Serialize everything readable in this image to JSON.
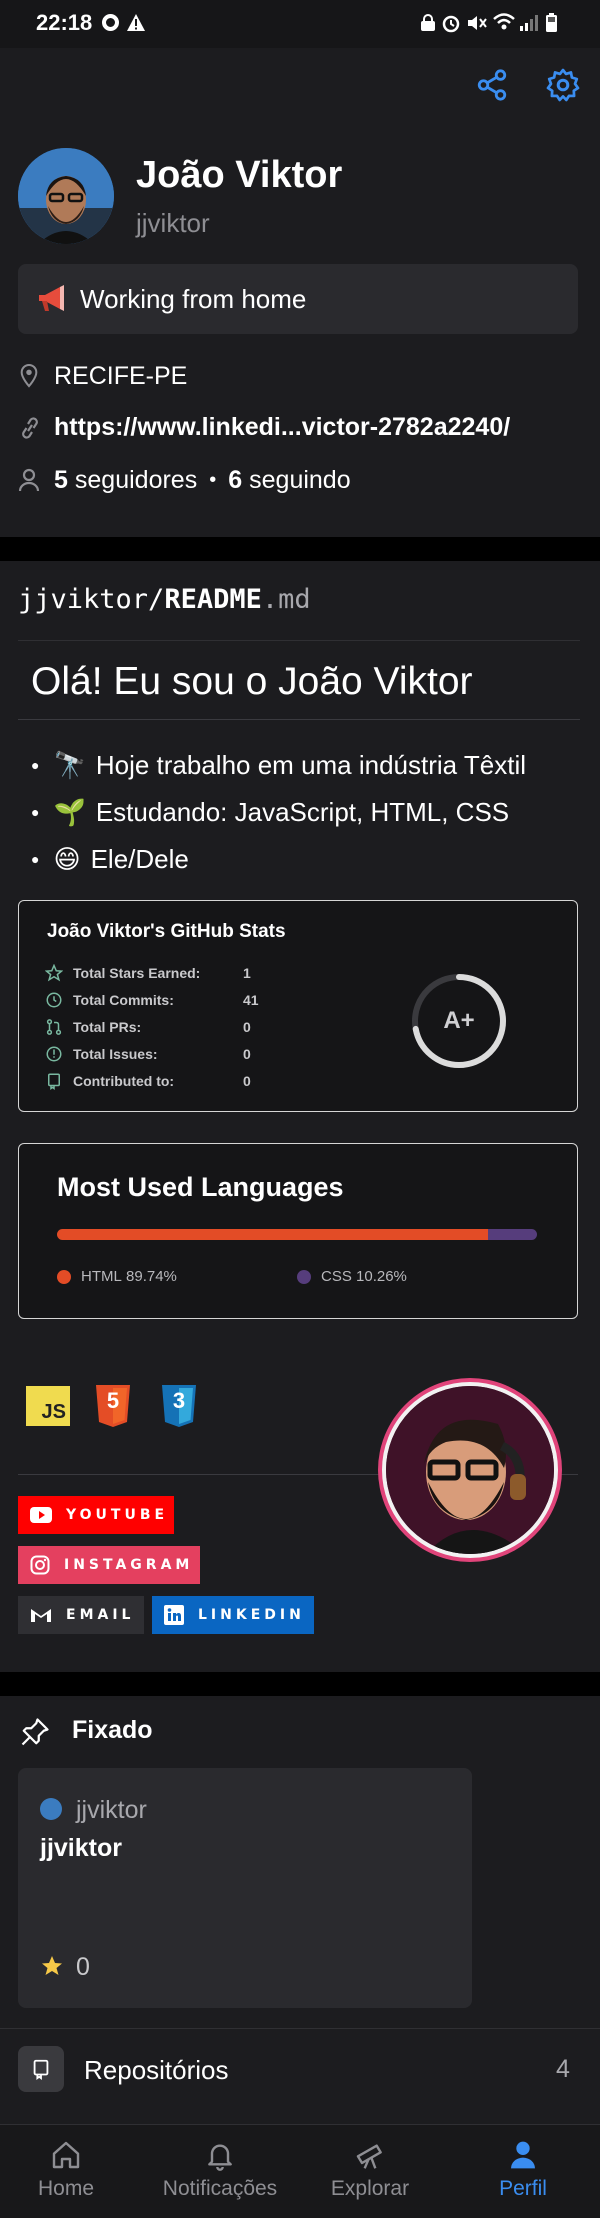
{
  "status_bar": {
    "time": "22:18"
  },
  "profile": {
    "name": "João Viktor",
    "username": "jjviktor",
    "status": "Working from home",
    "location": "RECIFE-PE",
    "link": "https://www.linkedi...victor-2782a2240/",
    "followers_count": "5",
    "followers_label": "seguidores",
    "following_count": "6",
    "following_label": "seguindo"
  },
  "readme": {
    "path_user": "jjviktor/",
    "path_file": "README",
    "path_ext": ".md",
    "heading": "Olá! Eu sou o João Viktor",
    "bullets": [
      {
        "emoji": "🔭",
        "text": "Hoje trabalho em uma indústria Têxtil"
      },
      {
        "emoji": "🌱",
        "text": "Estudando: JavaScript, HTML, CSS"
      },
      {
        "emoji": "😄",
        "text": "Ele/Dele"
      }
    ],
    "stats": {
      "title": "João Viktor's GitHub Stats",
      "rows": [
        {
          "label": "Total Stars Earned:",
          "value": "1",
          "icon": "star-icon"
        },
        {
          "label": "Total Commits:",
          "value": "41",
          "icon": "history-icon"
        },
        {
          "label": "Total PRs:",
          "value": "0",
          "icon": "pull-request-icon"
        },
        {
          "label": "Total Issues:",
          "value": "0",
          "icon": "issue-icon"
        },
        {
          "label": "Contributed to:",
          "value": "0",
          "icon": "repo-icon"
        }
      ],
      "grade": "A+",
      "grade_progress": 0.72
    },
    "languages": {
      "title": "Most Used Languages",
      "items": [
        {
          "name": "HTML",
          "percent": "89.74%",
          "share": 89.74,
          "color": "#e34c26"
        },
        {
          "name": "CSS",
          "percent": "10.26%",
          "share": 10.26,
          "color": "#563d7c"
        }
      ]
    },
    "tech_icons": [
      {
        "name": "javascript-icon",
        "label": "JS"
      },
      {
        "name": "html5-icon",
        "label": "5"
      },
      {
        "name": "css3-icon",
        "label": "3"
      }
    ],
    "badges": [
      {
        "label": "YOUTUBE",
        "color": "#ff0000",
        "icon": "youtube-icon"
      },
      {
        "label": "INSTAGRAM",
        "color": "#e4405f",
        "icon": "instagram-icon"
      },
      {
        "label": "EMAIL",
        "color": "#2f2f33",
        "icon": "gmail-icon"
      },
      {
        "label": "LINKEDIN",
        "color": "#0a66c2",
        "icon": "linkedin-icon"
      }
    ]
  },
  "pinned": {
    "heading": "Fixado",
    "card": {
      "owner": "jjviktor",
      "repo": "jjviktor",
      "stars": "0"
    }
  },
  "repositories": {
    "label": "Repositórios",
    "count": "4"
  },
  "bottom_nav": [
    {
      "label": "Home",
      "icon": "home-icon",
      "active": false
    },
    {
      "label": "Notificações",
      "icon": "bell-icon",
      "active": false
    },
    {
      "label": "Explorar",
      "icon": "telescope-icon",
      "active": false
    },
    {
      "label": "Perfil",
      "icon": "person-icon",
      "active": true
    }
  ],
  "colors": {
    "background": "#1c1c1f",
    "accent": "#3a8df0",
    "muted": "#8e8e93",
    "card": "#2a2a2e"
  }
}
